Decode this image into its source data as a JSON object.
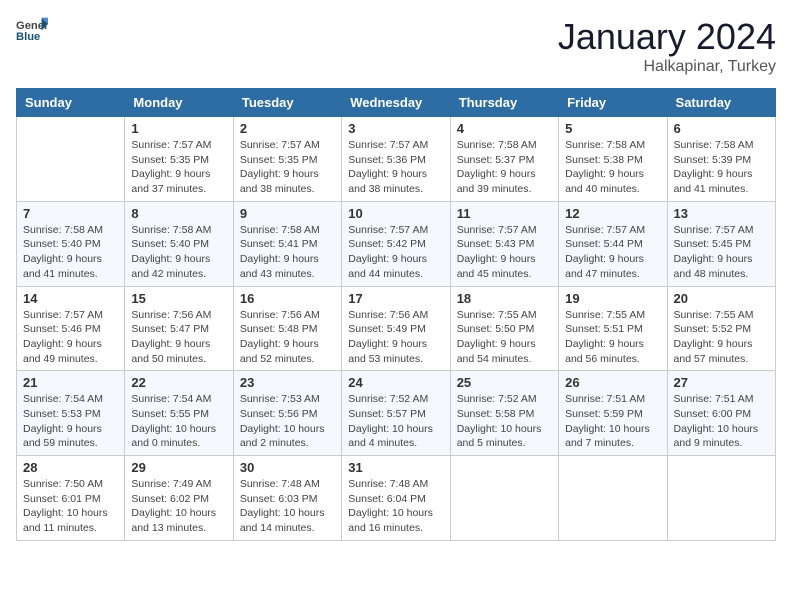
{
  "header": {
    "logo_general": "General",
    "logo_blue": "Blue",
    "title": "January 2024",
    "subtitle": "Halkapinar, Turkey"
  },
  "weekdays": [
    "Sunday",
    "Monday",
    "Tuesday",
    "Wednesday",
    "Thursday",
    "Friday",
    "Saturday"
  ],
  "weeks": [
    [
      {
        "day": "",
        "info": ""
      },
      {
        "day": "1",
        "info": "Sunrise: 7:57 AM\nSunset: 5:35 PM\nDaylight: 9 hours\nand 37 minutes."
      },
      {
        "day": "2",
        "info": "Sunrise: 7:57 AM\nSunset: 5:35 PM\nDaylight: 9 hours\nand 38 minutes."
      },
      {
        "day": "3",
        "info": "Sunrise: 7:57 AM\nSunset: 5:36 PM\nDaylight: 9 hours\nand 38 minutes."
      },
      {
        "day": "4",
        "info": "Sunrise: 7:58 AM\nSunset: 5:37 PM\nDaylight: 9 hours\nand 39 minutes."
      },
      {
        "day": "5",
        "info": "Sunrise: 7:58 AM\nSunset: 5:38 PM\nDaylight: 9 hours\nand 40 minutes."
      },
      {
        "day": "6",
        "info": "Sunrise: 7:58 AM\nSunset: 5:39 PM\nDaylight: 9 hours\nand 41 minutes."
      }
    ],
    [
      {
        "day": "7",
        "info": "Sunrise: 7:58 AM\nSunset: 5:40 PM\nDaylight: 9 hours\nand 41 minutes."
      },
      {
        "day": "8",
        "info": "Sunrise: 7:58 AM\nSunset: 5:40 PM\nDaylight: 9 hours\nand 42 minutes."
      },
      {
        "day": "9",
        "info": "Sunrise: 7:58 AM\nSunset: 5:41 PM\nDaylight: 9 hours\nand 43 minutes."
      },
      {
        "day": "10",
        "info": "Sunrise: 7:57 AM\nSunset: 5:42 PM\nDaylight: 9 hours\nand 44 minutes."
      },
      {
        "day": "11",
        "info": "Sunrise: 7:57 AM\nSunset: 5:43 PM\nDaylight: 9 hours\nand 45 minutes."
      },
      {
        "day": "12",
        "info": "Sunrise: 7:57 AM\nSunset: 5:44 PM\nDaylight: 9 hours\nand 47 minutes."
      },
      {
        "day": "13",
        "info": "Sunrise: 7:57 AM\nSunset: 5:45 PM\nDaylight: 9 hours\nand 48 minutes."
      }
    ],
    [
      {
        "day": "14",
        "info": "Sunrise: 7:57 AM\nSunset: 5:46 PM\nDaylight: 9 hours\nand 49 minutes."
      },
      {
        "day": "15",
        "info": "Sunrise: 7:56 AM\nSunset: 5:47 PM\nDaylight: 9 hours\nand 50 minutes."
      },
      {
        "day": "16",
        "info": "Sunrise: 7:56 AM\nSunset: 5:48 PM\nDaylight: 9 hours\nand 52 minutes."
      },
      {
        "day": "17",
        "info": "Sunrise: 7:56 AM\nSunset: 5:49 PM\nDaylight: 9 hours\nand 53 minutes."
      },
      {
        "day": "18",
        "info": "Sunrise: 7:55 AM\nSunset: 5:50 PM\nDaylight: 9 hours\nand 54 minutes."
      },
      {
        "day": "19",
        "info": "Sunrise: 7:55 AM\nSunset: 5:51 PM\nDaylight: 9 hours\nand 56 minutes."
      },
      {
        "day": "20",
        "info": "Sunrise: 7:55 AM\nSunset: 5:52 PM\nDaylight: 9 hours\nand 57 minutes."
      }
    ],
    [
      {
        "day": "21",
        "info": "Sunrise: 7:54 AM\nSunset: 5:53 PM\nDaylight: 9 hours\nand 59 minutes."
      },
      {
        "day": "22",
        "info": "Sunrise: 7:54 AM\nSunset: 5:55 PM\nDaylight: 10 hours\nand 0 minutes."
      },
      {
        "day": "23",
        "info": "Sunrise: 7:53 AM\nSunset: 5:56 PM\nDaylight: 10 hours\nand 2 minutes."
      },
      {
        "day": "24",
        "info": "Sunrise: 7:52 AM\nSunset: 5:57 PM\nDaylight: 10 hours\nand 4 minutes."
      },
      {
        "day": "25",
        "info": "Sunrise: 7:52 AM\nSunset: 5:58 PM\nDaylight: 10 hours\nand 5 minutes."
      },
      {
        "day": "26",
        "info": "Sunrise: 7:51 AM\nSunset: 5:59 PM\nDaylight: 10 hours\nand 7 minutes."
      },
      {
        "day": "27",
        "info": "Sunrise: 7:51 AM\nSunset: 6:00 PM\nDaylight: 10 hours\nand 9 minutes."
      }
    ],
    [
      {
        "day": "28",
        "info": "Sunrise: 7:50 AM\nSunset: 6:01 PM\nDaylight: 10 hours\nand 11 minutes."
      },
      {
        "day": "29",
        "info": "Sunrise: 7:49 AM\nSunset: 6:02 PM\nDaylight: 10 hours\nand 13 minutes."
      },
      {
        "day": "30",
        "info": "Sunrise: 7:48 AM\nSunset: 6:03 PM\nDaylight: 10 hours\nand 14 minutes."
      },
      {
        "day": "31",
        "info": "Sunrise: 7:48 AM\nSunset: 6:04 PM\nDaylight: 10 hours\nand 16 minutes."
      },
      {
        "day": "",
        "info": ""
      },
      {
        "day": "",
        "info": ""
      },
      {
        "day": "",
        "info": ""
      }
    ]
  ]
}
